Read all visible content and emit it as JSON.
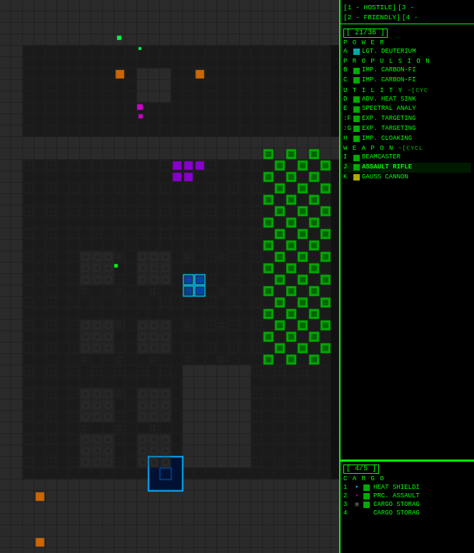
{
  "status": {
    "hostile_label": "[1 - HOSTILE]",
    "hostile_key": "[3 -",
    "friendly_label": "[2 - FRIENDLY]",
    "friendly_key": "[4 -"
  },
  "power": {
    "header": "[ 21/36 ]",
    "title": "P O W E R",
    "items": [
      {
        "key": "A",
        "color": "cyan",
        "text": "LGT. DEUTERIUM",
        "active": true
      }
    ]
  },
  "propulsion": {
    "title": "P R O P U L S I O N",
    "items": [
      {
        "key": "B",
        "color": "green",
        "text": "IMP. CARBON-FI"
      },
      {
        "key": "C",
        "color": "green",
        "text": "IMP. CARBON-FI"
      }
    ]
  },
  "utility": {
    "title": "U T I L I T Y",
    "cycle": "~[CYC",
    "items": [
      {
        "key": "D",
        "color": "green",
        "text": "ADV. HEAT SINK"
      },
      {
        "key": "E",
        "color": "green",
        "text": "SPECTRAL ANALY"
      },
      {
        "key": ":F",
        "color": "green",
        "text": "EXP. TARGETING"
      },
      {
        "key": ":G",
        "color": "green",
        "text": "EXP. TARGETING"
      },
      {
        "key": "H",
        "color": "green",
        "text": "IMP. CLOAKING"
      }
    ]
  },
  "weapon": {
    "title": "W E A P O N",
    "cycle": "~[CYCL",
    "items": [
      {
        "key": "I",
        "color": "green",
        "text": "BEAMCASTER"
      },
      {
        "key": "J",
        "color": "green",
        "text": "ASSAULT RIFLE",
        "highlight": true
      },
      {
        "key": "K",
        "color": "yellow",
        "text": "GAUSS CANNON"
      }
    ]
  },
  "cargo": {
    "header": "[ 4/5 ]",
    "title": "C A R G O",
    "items": [
      {
        "num": "1",
        "icon": "arrow-cyan",
        "color": "green",
        "text": "HEAT SHIELDI"
      },
      {
        "num": "2",
        "icon": "arrow-purple",
        "color": "green",
        "text": "PRC. ASSAULT"
      },
      {
        "num": "3",
        "icon": "box",
        "color": "green",
        "text": "CARGO STORAG"
      },
      {
        "num": "4",
        "icon": "none",
        "color": "none",
        "text": "CARGO STORAG"
      }
    ]
  }
}
